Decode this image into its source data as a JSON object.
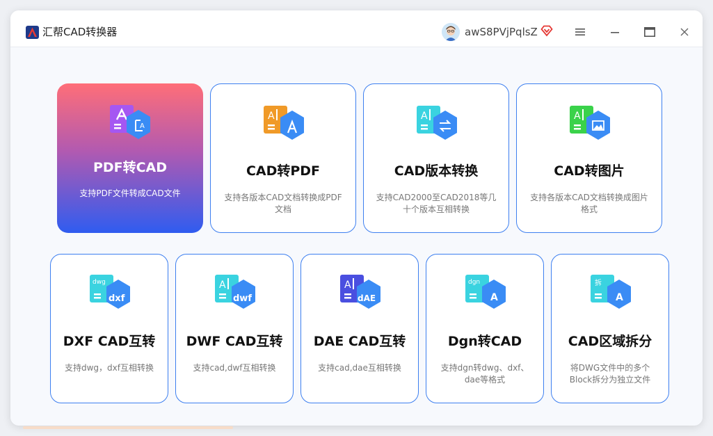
{
  "app": {
    "title": "汇帮CAD转换器"
  },
  "user": {
    "name": "awS8PVjPqlsZ"
  },
  "cards_row1": [
    {
      "title": "PDF转CAD",
      "desc": "支持PDF文件转成CAD文件",
      "icon_text": "A"
    },
    {
      "title": "CAD转PDF",
      "desc": "支持各版本CAD文档转换成PDF文档",
      "icon_text": "A"
    },
    {
      "title": "CAD版本转换",
      "desc": "支持CAD2000至CAD2018等几十个版本互相转换",
      "icon_text": "A"
    },
    {
      "title": "CAD转图片",
      "desc": "支持各版本CAD文档转换成图片格式",
      "icon_text": "A"
    }
  ],
  "cards_row2": [
    {
      "title": "DXF CAD互转",
      "desc": "支持dwg，dxf互相转换",
      "icon_top": "dwg",
      "icon_text": "dxf"
    },
    {
      "title": "DWF CAD互转",
      "desc": "支持cad,dwf互相转换",
      "icon_top": "A",
      "icon_text": "dwf"
    },
    {
      "title": "DAE CAD互转",
      "desc": "支持cad,dae互相转换",
      "icon_top": "A",
      "icon_text": "dAE"
    },
    {
      "title": "Dgn转CAD",
      "desc": "支持dgn转dwg、dxf、dae等格式",
      "icon_top": "dgn",
      "icon_text": "A"
    },
    {
      "title": "CAD区域拆分",
      "desc": "将DWG文件中的多个Block拆分为独立文件",
      "icon_top": "拆",
      "icon_text": "A"
    }
  ],
  "colors": {
    "accent": "#3d7ff0",
    "active_top": "#ff6e78",
    "active_bottom": "#2f5cf0"
  }
}
